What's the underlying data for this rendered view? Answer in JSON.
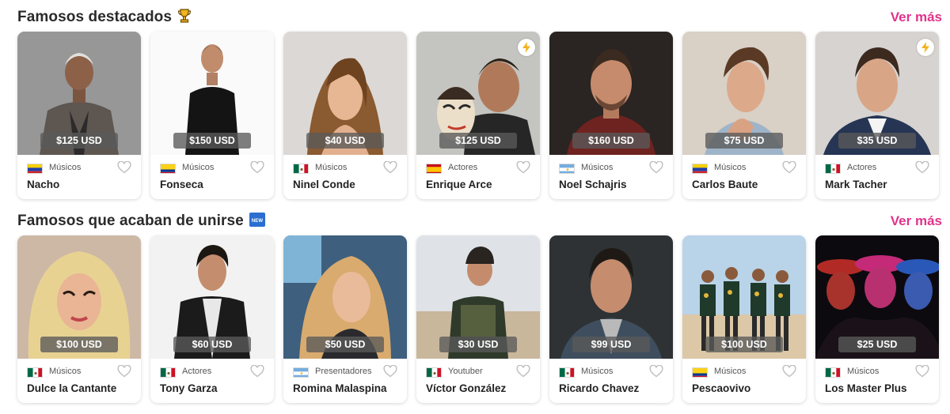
{
  "colors": {
    "accent": "#e0338a",
    "price_bg": "#5a5a5a",
    "card_bg": "#ffffff"
  },
  "sections": [
    {
      "title": "Famosos destacados",
      "title_icon": "trophy-icon",
      "see_more": "Ver más",
      "cards": [
        {
          "name": "Nacho",
          "category": "Músicos",
          "price": "$125 USD",
          "flag": "venezuela-flag-icon",
          "badge": "",
          "favorite_icon": "heart-icon"
        },
        {
          "name": "Fonseca",
          "category": "Músicos",
          "price": "$150 USD",
          "flag": "colombia-flag-icon",
          "badge": "",
          "favorite_icon": "heart-icon"
        },
        {
          "name": "Ninel Conde",
          "category": "Músicos",
          "price": "$40 USD",
          "flag": "mexico-flag-icon",
          "badge": "",
          "favorite_icon": "heart-icon"
        },
        {
          "name": "Enrique Arce",
          "category": "Actores",
          "price": "$125 USD",
          "flag": "spain-flag-icon",
          "badge": "lightning-bolt-icon",
          "favorite_icon": "heart-icon"
        },
        {
          "name": "Noel Schajris",
          "category": "Músicos",
          "price": "$160 USD",
          "flag": "argentina-flag-icon",
          "badge": "",
          "favorite_icon": "heart-icon"
        },
        {
          "name": "Carlos Baute",
          "category": "Músicos",
          "price": "$75 USD",
          "flag": "venezuela-flag-icon",
          "badge": "",
          "favorite_icon": "heart-icon"
        },
        {
          "name": "Mark Tacher",
          "category": "Actores",
          "price": "$35 USD",
          "flag": "mexico-flag-icon",
          "badge": "lightning-bolt-icon",
          "favorite_icon": "heart-icon"
        }
      ]
    },
    {
      "title": "Famosos que acaban de unirse",
      "title_icon": "new-badge-icon",
      "title_icon_text": "NEW",
      "see_more": "Ver más",
      "cards": [
        {
          "name": "Dulce la Cantante",
          "category": "Músicos",
          "price": "$100 USD",
          "flag": "mexico-flag-icon",
          "badge": "",
          "favorite_icon": "heart-icon"
        },
        {
          "name": "Tony Garza",
          "category": "Actores",
          "price": "$60 USD",
          "flag": "mexico-flag-icon",
          "badge": "",
          "favorite_icon": "heart-icon"
        },
        {
          "name": "Romina Malaspina",
          "category": "Presentadores",
          "price": "$50 USD",
          "flag": "argentina-flag-icon",
          "badge": "",
          "favorite_icon": "heart-icon"
        },
        {
          "name": "Víctor González",
          "category": "Youtuber",
          "price": "$30 USD",
          "flag": "mexico-flag-icon",
          "badge": "",
          "favorite_icon": "heart-icon"
        },
        {
          "name": "Ricardo Chavez",
          "category": "Músicos",
          "price": "$99 USD",
          "flag": "mexico-flag-icon",
          "badge": "",
          "favorite_icon": "heart-icon"
        },
        {
          "name": "Pescaovivo",
          "category": "Músicos",
          "price": "$100 USD",
          "flag": "colombia-flag-icon",
          "badge": "",
          "favorite_icon": "heart-icon"
        },
        {
          "name": "Los Master Plus",
          "category": "Músicos",
          "price": "$25 USD",
          "flag": "mexico-flag-icon",
          "badge": "",
          "favorite_icon": "heart-icon"
        }
      ]
    }
  ]
}
